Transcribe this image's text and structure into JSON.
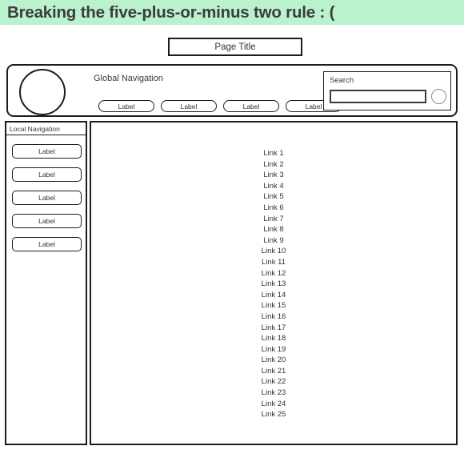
{
  "banner": {
    "title": "Breaking the five-plus-or-minus two rule : ("
  },
  "page_title": {
    "label": "Page Title"
  },
  "global_nav": {
    "heading": "Global Navigation",
    "buttons": [
      {
        "label": "Label"
      },
      {
        "label": "Label"
      },
      {
        "label": "Label"
      },
      {
        "label": "Label"
      }
    ]
  },
  "search": {
    "label": "Search",
    "value": "",
    "placeholder": ""
  },
  "local_nav": {
    "heading": "Local Navigation",
    "buttons": [
      {
        "label": "Label"
      },
      {
        "label": "Label"
      },
      {
        "label": "Label"
      },
      {
        "label": "Label"
      },
      {
        "label": "Label"
      }
    ]
  },
  "content": {
    "links": [
      "Link 1",
      "Link 2",
      "Link 3",
      "Link 4",
      "Link 5",
      "Link 6",
      "Link 7",
      "Link 8",
      "Link 9",
      "Link 10",
      "Link 11",
      "Link 12",
      "Link 13",
      "Link 14",
      "Link 15",
      "Link 16",
      "Link 17",
      "Link 18",
      "Link 19",
      "Link 20",
      "Link 21",
      "Link 22",
      "Link 23",
      "Link 24",
      "Link 25"
    ]
  },
  "colors": {
    "banner_background": "#b9f2cd",
    "banner_text": "#3c3c3c",
    "outline": "#1c1c1c",
    "page_background": "#ffffff"
  }
}
